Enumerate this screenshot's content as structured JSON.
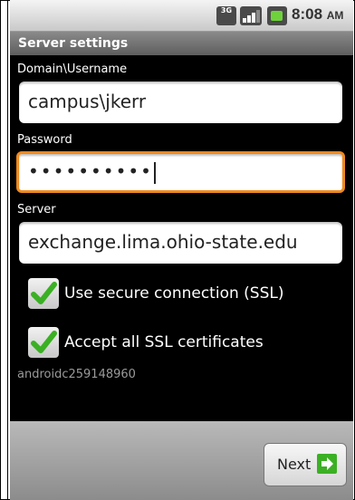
{
  "status_bar": {
    "network_type": "3G",
    "time": "8:08",
    "time_suffix": "AM"
  },
  "title": "Server settings",
  "form": {
    "domain_label": "Domain\\Username",
    "domain_value": "campus\\jkerr",
    "password_label": "Password",
    "password_value": "••••••••••",
    "server_label": "Server",
    "server_value": "exchange.lima.ohio-state.edu",
    "ssl_label": "Use secure connection (SSL)",
    "ssl_checked": true,
    "accept_certs_label": "Accept all SSL certificates",
    "accept_certs_checked": true,
    "device_id": "androidc259148960"
  },
  "footer": {
    "next_label": "Next"
  },
  "colors": {
    "focus": "#f08a1e",
    "check": "#3bb024",
    "battery": "#6ed23b"
  },
  "icons": [
    "3g-icon",
    "signal-icon",
    "battery-icon",
    "checkmark-icon",
    "next-arrow-icon"
  ]
}
